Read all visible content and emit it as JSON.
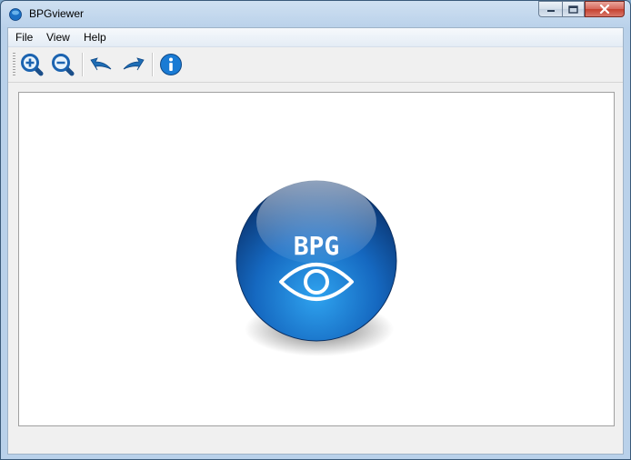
{
  "window": {
    "title": "BPGviewer"
  },
  "menu": {
    "items": [
      "File",
      "View",
      "Help"
    ]
  },
  "toolbar": {
    "buttons": [
      "zoom-in-icon",
      "zoom-out-icon",
      "rotate-left-icon",
      "rotate-right-icon",
      "info-icon"
    ]
  },
  "viewer": {
    "logo_text": "BPG"
  },
  "colors": {
    "accent": "#1a6fc4",
    "logo_dark": "#0b3f7d",
    "logo_light": "#2b9be8"
  }
}
